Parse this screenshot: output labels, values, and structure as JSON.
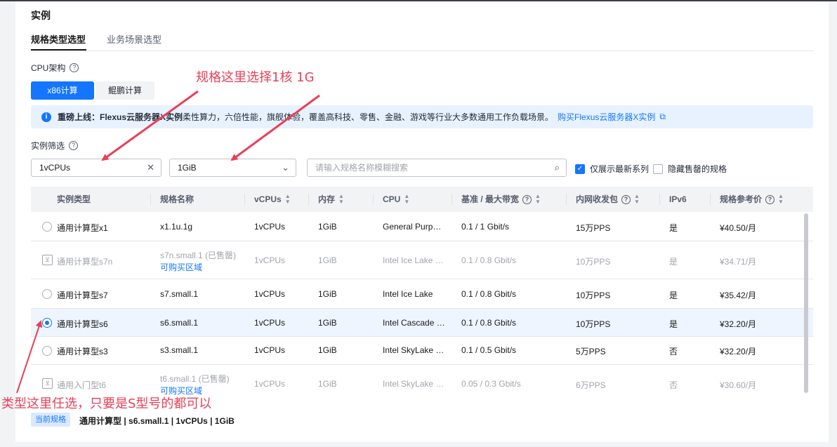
{
  "section_title": "实例",
  "tabs": [
    {
      "label": "规格类型选型",
      "active": true
    },
    {
      "label": "业务场景选型",
      "active": false
    }
  ],
  "cpu_arch": {
    "label": "CPU架构",
    "options": [
      {
        "label": "x86计算",
        "selected": true
      },
      {
        "label": "鲲鹏计算",
        "selected": false
      }
    ]
  },
  "notice": {
    "bold": "重磅上线：Flexus云服务器X实例",
    "text": " 柔性算力，六倍性能，旗舰体验，覆盖高科技、零售、金融、游戏等行业大多数通用工作负载场景。",
    "link": "购买Flexus云服务器X实例"
  },
  "filter": {
    "label": "实例筛选",
    "vcpu_value": "1vCPUs",
    "memory_value": "1GiB",
    "search_placeholder": "请输入规格名称模糊搜索",
    "latest_only_label": "仅展示最新系列",
    "latest_only_checked": true,
    "hide_sold_out_label": "隐藏售罄的规格",
    "hide_sold_out_checked": false
  },
  "table": {
    "headers": [
      "实例类型",
      "规格名称",
      "vCPUs",
      "内存",
      "CPU",
      "基准 / 最大带宽",
      "内网收发包",
      "IPv6",
      "规格参考价"
    ],
    "rows": [
      {
        "type": "通用计算型x1",
        "spec": "x1.1u.1g",
        "spec_sub": "",
        "vcpus": "1vCPUs",
        "mem": "1GiB",
        "cpu": "General Purp…",
        "bw": "0.1 / 1 Gbit/s",
        "pps": "15万PPS",
        "ipv6": "是",
        "price": "¥40.50/月",
        "state": "available",
        "selected": false
      },
      {
        "type": "通用计算型s7n",
        "spec": "s7n.small.1 (已售罄)",
        "spec_sub": "可购买区域",
        "vcpus": "1vCPUs",
        "mem": "1GiB",
        "cpu": "Intel Ice Lake …",
        "bw": "0.1 / 0.8 Gbit/s",
        "pps": "10万PPS",
        "ipv6": "是",
        "price": "¥34.71/月",
        "state": "sold_out",
        "selected": false
      },
      {
        "type": "通用计算型s7",
        "spec": "s7.small.1",
        "spec_sub": "",
        "vcpus": "1vCPUs",
        "mem": "1GiB",
        "cpu": "Intel Ice Lake",
        "bw": "0.1 / 0.8 Gbit/s",
        "pps": "10万PPS",
        "ipv6": "是",
        "price": "¥35.42/月",
        "state": "available",
        "selected": false
      },
      {
        "type": "通用计算型s6",
        "spec": "s6.small.1",
        "spec_sub": "",
        "vcpus": "1vCPUs",
        "mem": "1GiB",
        "cpu": "Intel Cascade …",
        "bw": "0.1 / 0.8 Gbit/s",
        "pps": "10万PPS",
        "ipv6": "是",
        "price": "¥32.20/月",
        "state": "available",
        "selected": true
      },
      {
        "type": "通用计算型s3",
        "spec": "s3.small.1",
        "spec_sub": "",
        "vcpus": "1vCPUs",
        "mem": "1GiB",
        "cpu": "Intel SkyLake …",
        "bw": "0.1 / 0.5 Gbit/s",
        "pps": "5万PPS",
        "ipv6": "否",
        "price": "¥32.20/月",
        "state": "available",
        "selected": false
      },
      {
        "type": "通用入门型t6",
        "spec": "t6.small.1 (已售罄)",
        "spec_sub": "可购买区域",
        "vcpus": "1vCPUs",
        "mem": "1GiB",
        "cpu": "Intel SkyLake …",
        "bw": "0.05 / 0.3 Gbit/s",
        "pps": "6万PPS",
        "ipv6": "否",
        "price": "¥30.60/月",
        "state": "sold_out",
        "selected": false
      }
    ]
  },
  "current_spec": {
    "tag": "当前规格",
    "text": "通用计算型 | s6.small.1 | 1vCPUs | 1GiB"
  },
  "annotations": {
    "top": "规格这里选择1核 1G",
    "bottom": "类型这里任选，只要是S型号的都可以",
    "color": "#e84057"
  },
  "colors": {
    "accent": "#1476ff",
    "notice_bg": "#e8f2ff",
    "selected_row_bg": "#eef5ff"
  }
}
